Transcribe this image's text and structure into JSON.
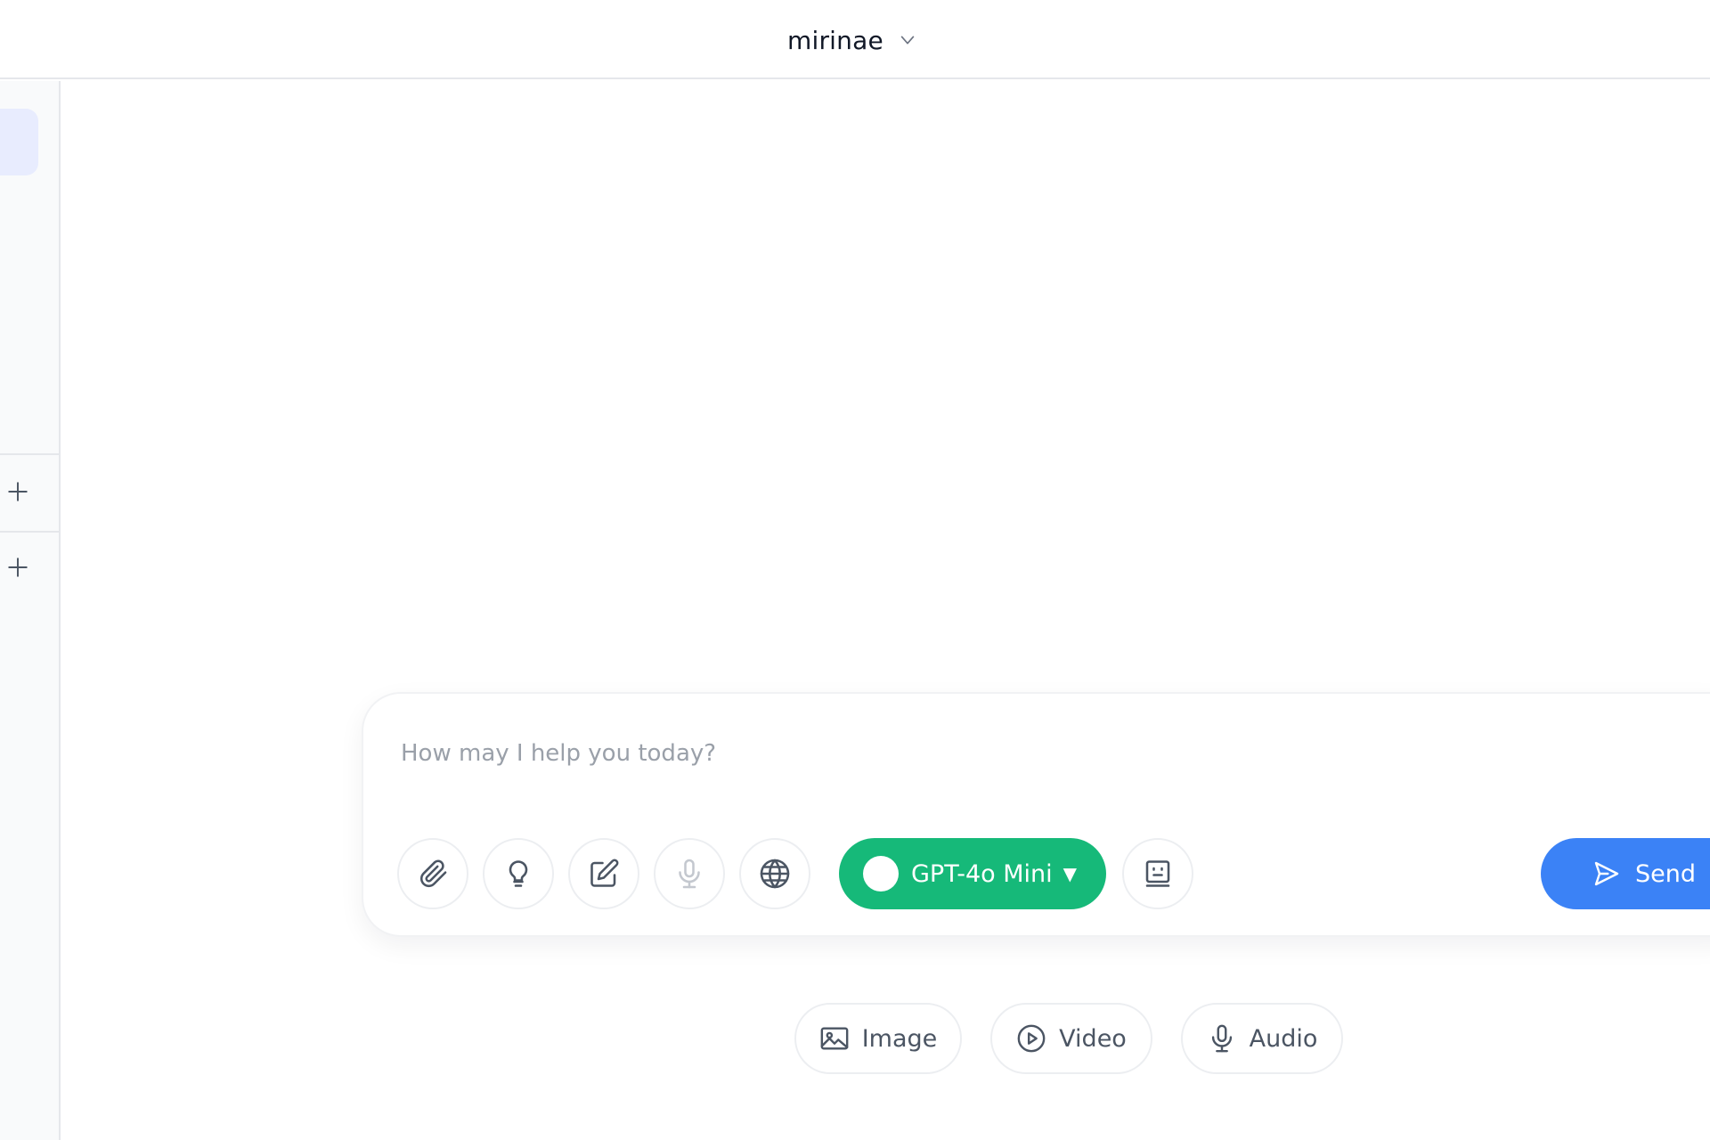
{
  "header": {
    "workspace_name": "mirinae"
  },
  "sidebar": {
    "add_buttons": [
      "+",
      "+"
    ]
  },
  "composer": {
    "placeholder": "How may I help you today?",
    "value": "",
    "tools": [
      {
        "name": "attach",
        "icon": "paperclip-icon"
      },
      {
        "name": "ideas",
        "icon": "lightbulb-icon"
      },
      {
        "name": "edit",
        "icon": "edit-icon"
      },
      {
        "name": "voice",
        "icon": "microphone-icon"
      },
      {
        "name": "web",
        "icon": "globe-icon"
      },
      {
        "name": "assistant",
        "icon": "bot-face-icon"
      }
    ],
    "model": {
      "label": "GPT-4o Mini",
      "caret": "▼",
      "color": "#16b979"
    },
    "send": {
      "label": "Send",
      "icon": "send-icon",
      "color": "#3b82f6"
    }
  },
  "media_types": [
    {
      "label": "Image",
      "icon": "image-icon"
    },
    {
      "label": "Video",
      "icon": "play-circle-icon"
    },
    {
      "label": "Audio",
      "icon": "microphone-icon"
    }
  ]
}
